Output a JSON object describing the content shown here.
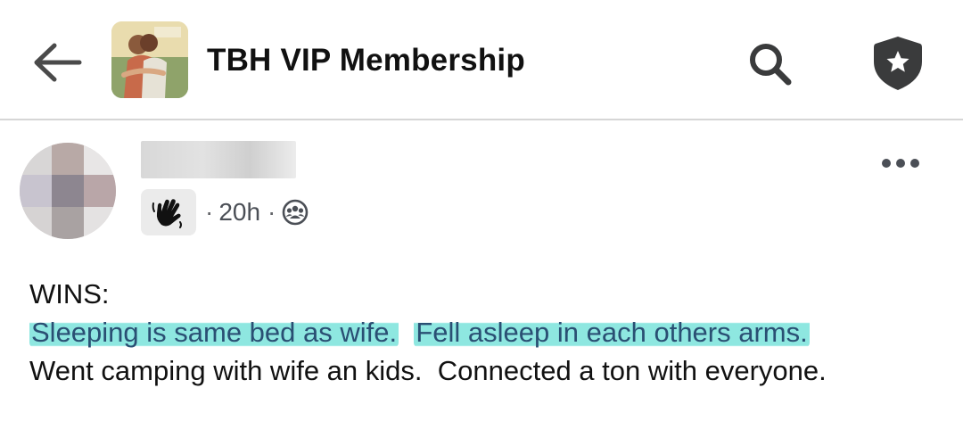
{
  "header": {
    "title": "TBH VIP Membership",
    "back_icon": "arrow-left-icon",
    "search_icon": "search-icon",
    "shield_icon": "shield-star-icon"
  },
  "post": {
    "time": "20h",
    "separator": "·",
    "privacy_icon": "group-members-icon",
    "badge_icon": "waving-hand-icon",
    "more_icon": "more-options-icon",
    "body": {
      "heading": "WINS:",
      "highlight_1": "Sleeping is same bed as wife.",
      "highlight_2": "Fell asleep in each others arms.",
      "line_3": "Went camping with wife an kids.  Connected a ton with everyone."
    }
  },
  "colors": {
    "highlight": "#6ee0d8",
    "highlight_text": "#2a4f73",
    "icon_dark": "#3a3b3c"
  }
}
